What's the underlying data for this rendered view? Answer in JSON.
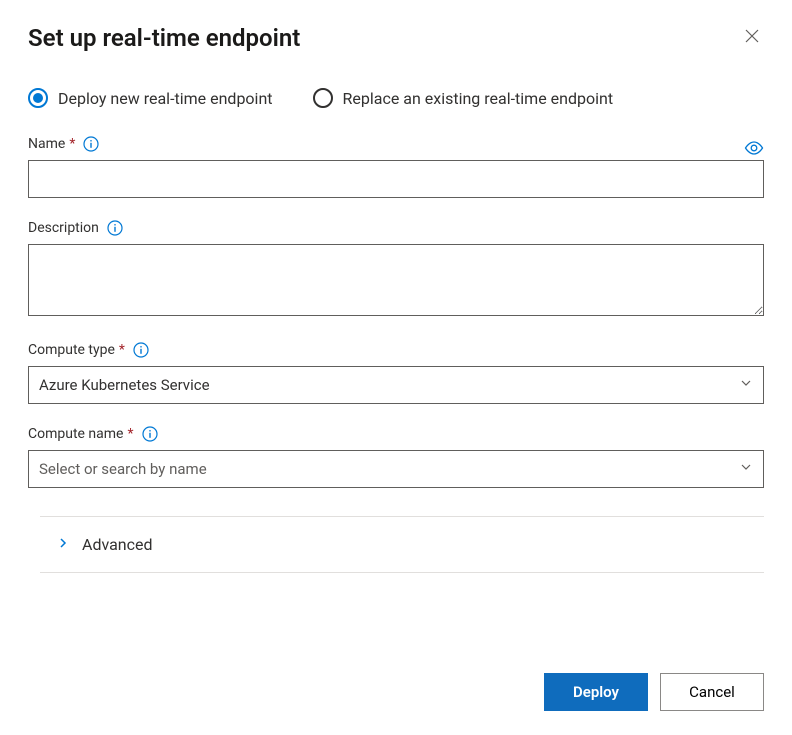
{
  "dialog": {
    "title": "Set up real-time endpoint"
  },
  "radios": {
    "deploy_new": "Deploy new real-time endpoint",
    "replace_existing": "Replace an existing real-time endpoint"
  },
  "fields": {
    "name": {
      "label": "Name",
      "value": ""
    },
    "description": {
      "label": "Description",
      "value": ""
    },
    "compute_type": {
      "label": "Compute type",
      "value": "Azure Kubernetes Service"
    },
    "compute_name": {
      "label": "Compute name",
      "placeholder": "Select or search by name"
    }
  },
  "advanced": {
    "label": "Advanced"
  },
  "buttons": {
    "deploy": "Deploy",
    "cancel": "Cancel"
  }
}
